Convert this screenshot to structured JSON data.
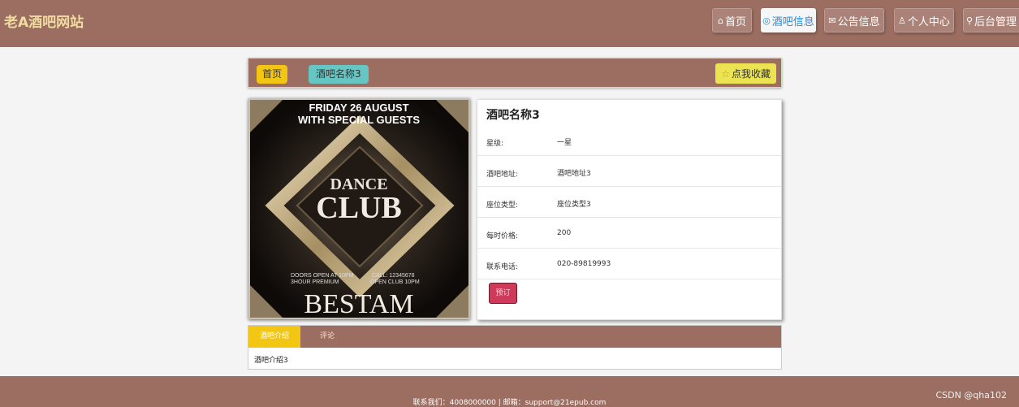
{
  "header": {
    "site_title": "老A酒吧网站",
    "nav": [
      {
        "label": "首页",
        "icon": "home-icon"
      },
      {
        "label": "酒吧信息",
        "icon": "disc-icon"
      },
      {
        "label": "公告信息",
        "icon": "mail-icon"
      },
      {
        "label": "个人中心",
        "icon": "user-icon"
      },
      {
        "label": "后台管理",
        "icon": "link-icon"
      }
    ]
  },
  "breadcrumb": {
    "home": "首页",
    "current": "酒吧名称3",
    "favorite": "点我收藏"
  },
  "poster": {
    "line1": "FRIDAY 26 AUGUST",
    "line2": "WITH SPECIAL GUESTS",
    "dance": "DANCE",
    "club": "CLUB",
    "small_left": "DOORS OPEN AT 10PM",
    "small_left2": "3HOUR PREMIUM",
    "small_right": "CALL: 12345678",
    "small_right2": "OPEN CLUB 10PM",
    "bottom": "BESTAM"
  },
  "detail": {
    "title": "酒吧名称3",
    "rows": [
      {
        "label": "星级:",
        "value": "一星"
      },
      {
        "label": "酒吧地址:",
        "value": "酒吧地址3"
      },
      {
        "label": "座位类型:",
        "value": "座位类型3"
      },
      {
        "label": "每时价格:",
        "value": "200"
      },
      {
        "label": "联系电话:",
        "value": "020-89819993"
      }
    ],
    "book_label": "预订"
  },
  "tabs": {
    "active": "酒吧介绍",
    "other": "评论",
    "content": "酒吧介绍3"
  },
  "footer": {
    "text": "联系我们：4008000000 | 邮箱：support@21epub.com",
    "watermark": "CSDN @qha102"
  }
}
